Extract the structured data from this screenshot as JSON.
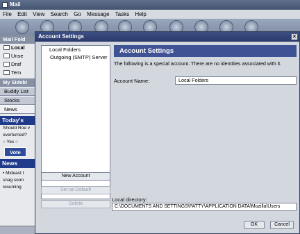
{
  "mail": {
    "title": "Mail",
    "menu": [
      "File",
      "Edit",
      "View",
      "Search",
      "Go",
      "Message",
      "Tasks",
      "Help"
    ],
    "folders_header": "Mail Fold",
    "folders": [
      "Local",
      "Unse",
      "Draf",
      "Tem"
    ],
    "sidebar_header": "My Sidebi",
    "sidebar_tabs": [
      "Buddy List",
      "Stocks",
      "News"
    ],
    "poll_title": "Today's",
    "poll_question": [
      "Should Roe v",
      "overturned?"
    ],
    "poll_options": "Yes",
    "vote_label": "Vote",
    "news_title": "News",
    "news_text": [
      "• Mideast t",
      "snag soon",
      "resuming"
    ]
  },
  "dialog": {
    "title": "Account Settings",
    "close_glyph": "×",
    "tree": [
      "Local Folders",
      "Outgoing (SMTP) Server"
    ],
    "buttons": {
      "new_account": "New Account",
      "set_default": "Set as Default",
      "delete": "Delete",
      "ok": "OK",
      "cancel": "Cancel"
    },
    "panel": {
      "header": "Account Settings",
      "description": "The following is a special account. There are no identities associated with it.",
      "name_label": "Account Name:",
      "name_value": "Local Folders",
      "dir_label": "Local directory:",
      "dir_value": "C:\\DOCUMENTS AND SETTINGS\\PATTY\\APPLICATION DATA\\Mozilla\\Users"
    }
  }
}
